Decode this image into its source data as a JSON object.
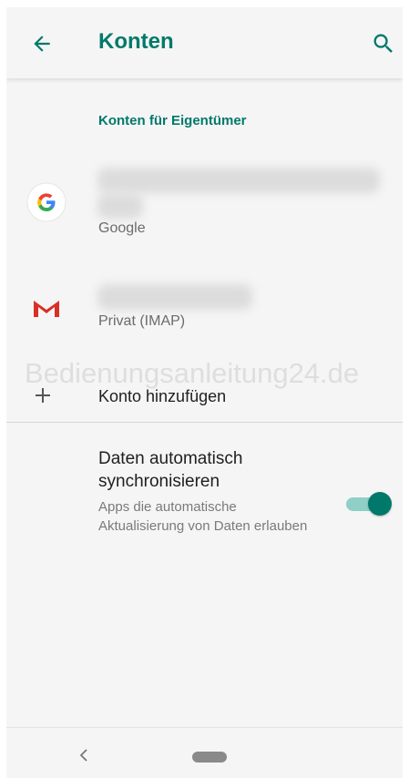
{
  "appbar": {
    "title": "Konten",
    "back_icon": "arrow-left-icon",
    "search_icon": "search-icon"
  },
  "section": {
    "header": "Konten für Eigentümer"
  },
  "accounts": [
    {
      "type": "Google",
      "icon": "google-icon"
    },
    {
      "type": "Privat (IMAP)",
      "icon": "gmail-icon"
    }
  ],
  "add_account": {
    "label": "Konto hinzufügen",
    "icon": "plus-icon"
  },
  "watermark": "Bedienungsanleitung24.de",
  "sync": {
    "title": "Daten automatisch synchronisieren",
    "description": "Apps die automatische Aktualisierung von Daten erlauben",
    "enabled": true
  },
  "navbar": {
    "back_icon": "nav-back-icon",
    "home_icon": "nav-home-pill-icon"
  },
  "colors": {
    "accent": "#00796b",
    "toggle_track": "#8fd0c6",
    "background": "#f5f5f5"
  }
}
